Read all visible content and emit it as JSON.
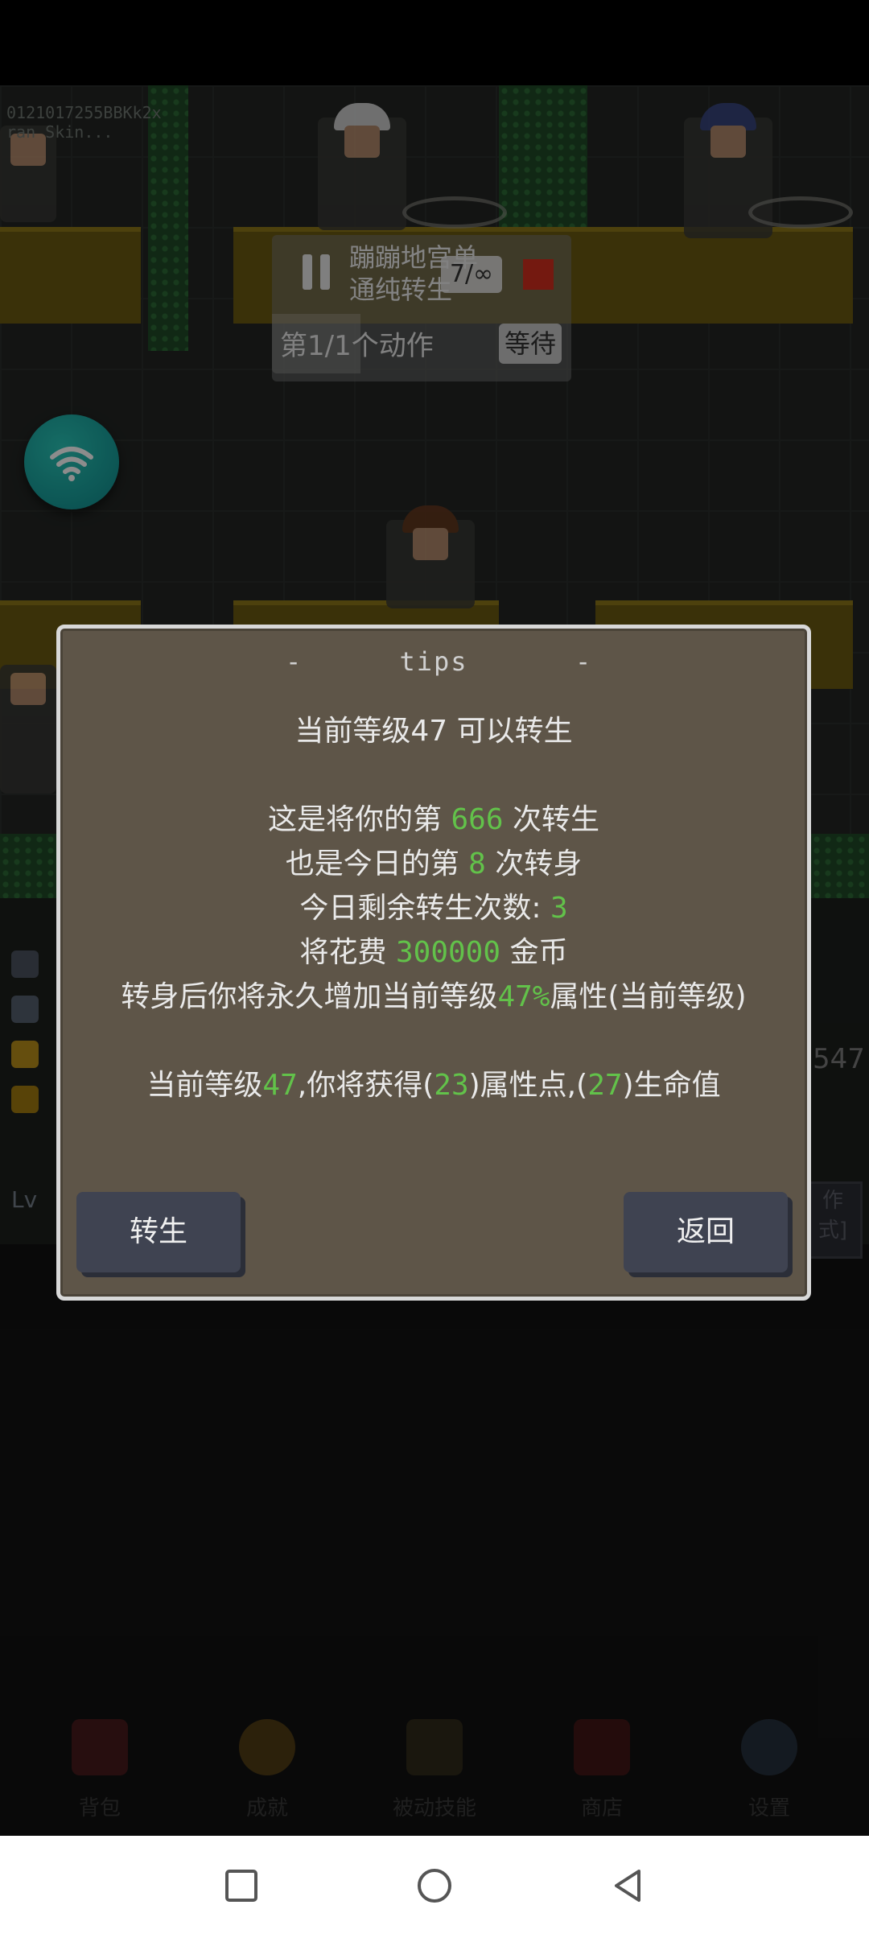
{
  "background": {
    "device_tag_lines": [
      "0121017255BBKk2x",
      "ran Skin..."
    ],
    "side_number": "547",
    "lv_label": "Lv",
    "right_panel_text": "作\n式]",
    "tabs": [
      {
        "label": "背包",
        "icon": "backpack-icon"
      },
      {
        "label": "成就",
        "icon": "medal-icon"
      },
      {
        "label": "被动技能",
        "icon": "skill-book-icon"
      },
      {
        "label": "商店",
        "icon": "shop-icon"
      },
      {
        "label": "设置",
        "icon": "gear-icon"
      }
    ]
  },
  "macro": {
    "title_line1": "蹦蹦地宫单",
    "title_line2": "通纯转生",
    "count": "7/∞",
    "step": "第1/1个动作",
    "wait": "等待"
  },
  "dialog": {
    "dash_left": "-",
    "title": "tips",
    "dash_right": "-",
    "line1": "当前等级47 可以转生",
    "line2": {
      "pre": "这是将你的第 ",
      "value": "666",
      "post": " 次转生"
    },
    "line3": {
      "pre": "也是今日的第 ",
      "value": "8",
      "post": " 次转身"
    },
    "line4": {
      "pre": "今日剩余转生次数: ",
      "value": "3"
    },
    "line5": {
      "pre": "将花费 ",
      "value": "300000",
      "post": " 金币"
    },
    "line6": {
      "pre": "转身后你将永久增加当前等级",
      "value": "47%",
      "post": "属性(当前等级)"
    },
    "line7": {
      "pre": "当前等级",
      "level": "47",
      "mid1": ",你将获得(",
      "attr_points": "23",
      "mid2": ")属性点,(",
      "hp": "27",
      "post": ")生命值"
    },
    "rebirth_button": "转生",
    "back_button": "返回"
  },
  "colors": {
    "dialog_bg": "#5e5548",
    "highlight": "#62c24a",
    "button_bg": "#3f4351",
    "wifi_button": "#1aa9a3",
    "stop": "#d42f1e"
  }
}
